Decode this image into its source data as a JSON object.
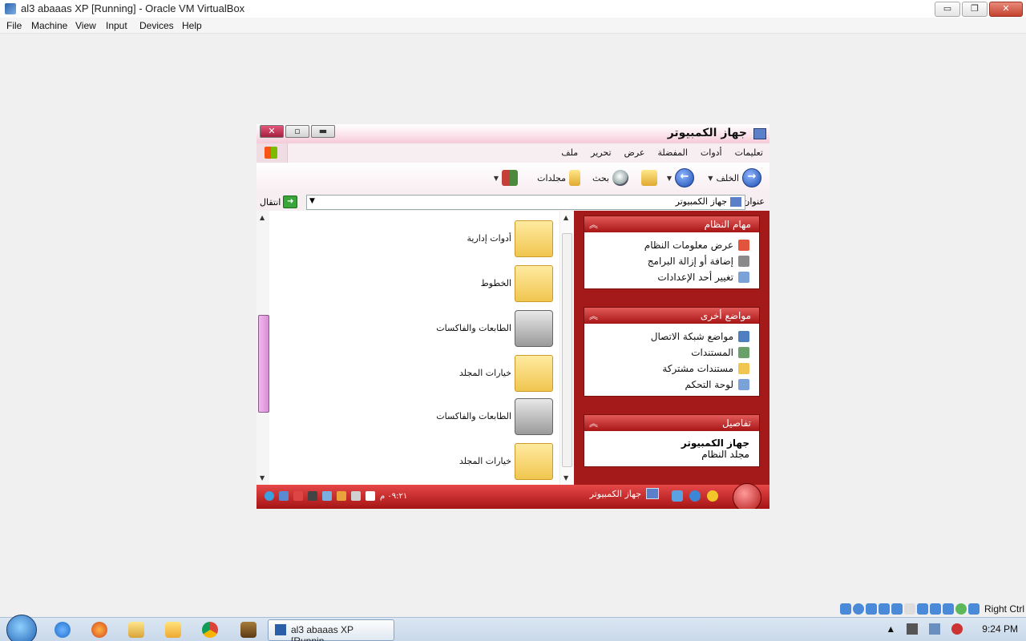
{
  "host": {
    "title": "al3 abaaas XP [Running] - Oracle VM VirtualBox",
    "window_buttons": {
      "minimize": "▭",
      "restore": "❐",
      "close": "✕"
    },
    "menu": [
      "File",
      "Machine",
      "View",
      "Input",
      "Devices",
      "Help"
    ],
    "status_label": "Right Ctrl",
    "clock": "9:24 PM",
    "taskbar_app": "al3 abaaas XP [Runnin..."
  },
  "guest": {
    "window_title": "جهاز الكمبيوتر",
    "window_buttons": {
      "close": "✕",
      "max": "▫",
      "min": "▬"
    },
    "menu": [
      "ملف",
      "تحرير",
      "عرض",
      "المفضلة",
      "أدوات",
      "تعليمات"
    ],
    "toolbar": {
      "back": "الخلف",
      "search": "بحث",
      "folders": "مجلدات"
    },
    "address": {
      "label": "عنوان",
      "value": "جهاز الكمبيوتر",
      "go": "انتقال"
    },
    "files": [
      {
        "label": "أدوات إدارية",
        "icon": "admin-tools-icon"
      },
      {
        "label": "الخطوط",
        "icon": "fonts-folder-icon"
      },
      {
        "label": "الطابعات والفاكسات",
        "icon": "printer-icon"
      },
      {
        "label": "خيارات المجلد",
        "icon": "folder-options-icon"
      },
      {
        "label": "الطابعات والفاكسات",
        "icon": "printer-icon"
      },
      {
        "label": "خيارات المجلد",
        "icon": "folder-options-icon"
      }
    ],
    "panels": {
      "system_tasks": {
        "title": "مهام النظام",
        "links": [
          "عرض معلومات النظام",
          "إضافة أو إزالة البرامج",
          "تغيير أحد الإعدادات"
        ]
      },
      "other_places": {
        "title": "مواضع أخرى",
        "links": [
          "مواضع شبكة الاتصال",
          "المستندات",
          "مستندات مشتركة",
          "لوحة التحكم"
        ]
      },
      "details": {
        "title": "تفاصيل",
        "name": "جهاز الكمبيوتر",
        "type": "مجلد النظام"
      }
    },
    "taskbar": {
      "task_label": "جهاز الكمبيوتر",
      "clock": "٠٩:٢١ م"
    }
  }
}
